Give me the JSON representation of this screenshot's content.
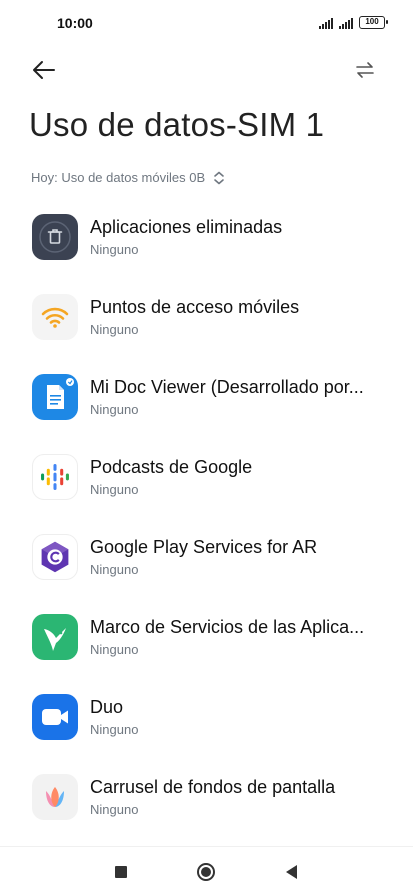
{
  "status_bar": {
    "time": "10:00",
    "battery": "100"
  },
  "toolbar": {
    "back_icon": "arrow-left-icon",
    "filter_icon": "swap-arrows-icon"
  },
  "title": "Uso de datos-SIM 1",
  "period_selector": {
    "label": "Hoy: Uso de datos móviles 0B",
    "icon": "unfold-chevrons-icon"
  },
  "apps": [
    {
      "name": "Aplicaciones eliminadas",
      "usage": "Ninguno",
      "icon": "trash-icon"
    },
    {
      "name": "Puntos de acceso móviles",
      "usage": "Ninguno",
      "icon": "wifi-hotspot-icon"
    },
    {
      "name": "Mi Doc Viewer (Desarrollado por...",
      "usage": "Ninguno",
      "icon": "document-icon"
    },
    {
      "name": "Podcasts de Google",
      "usage": "Ninguno",
      "icon": "google-podcasts-icon"
    },
    {
      "name": "Google Play Services for AR",
      "usage": "Ninguno",
      "icon": "ar-core-icon"
    },
    {
      "name": "Marco de Servicios de las Aplica...",
      "usage": "Ninguno",
      "icon": "hummingbird-icon"
    },
    {
      "name": "Duo",
      "usage": "Ninguno",
      "icon": "video-camera-icon"
    },
    {
      "name": "Carrusel de fondos de pantalla",
      "usage": "Ninguno",
      "icon": "tulip-icon"
    }
  ],
  "nav_bar": {
    "recents_icon": "square-icon",
    "home_icon": "circle-icon",
    "back_icon": "triangle-back-icon"
  },
  "colors": {
    "trash_bg": "#3b4252",
    "hotspot_orange": "#f5a623",
    "doc_blue": "#1e88e5",
    "ar_purple": "#5e35b1",
    "hummingbird_green": "#2bb673",
    "duo_blue": "#1a73e8"
  }
}
